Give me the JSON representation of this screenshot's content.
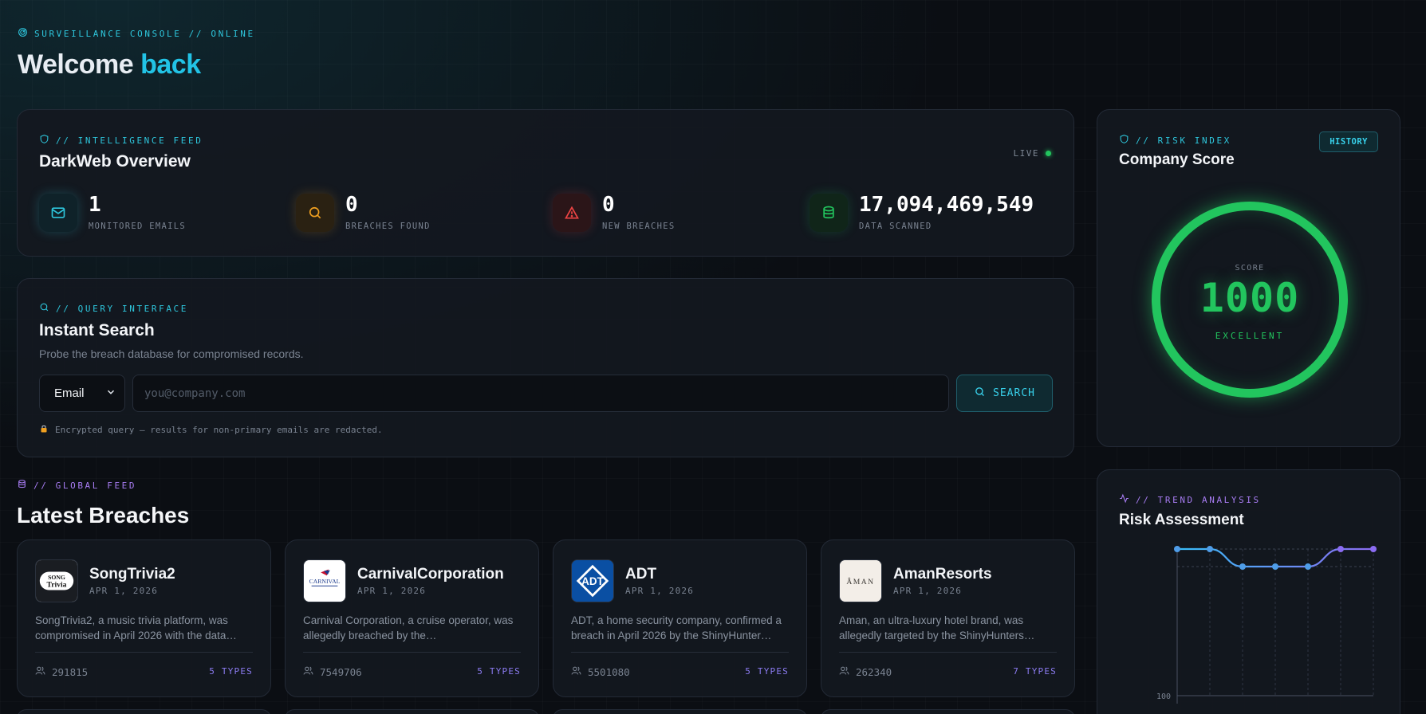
{
  "header": {
    "kicker": "SURVEILLANCE CONSOLE // ONLINE",
    "title_prefix": "Welcome",
    "title_accent": "back"
  },
  "overview": {
    "kicker": "// INTELLIGENCE FEED",
    "title": "DarkWeb Overview",
    "live_label": "LIVE",
    "stats": [
      {
        "value": "1",
        "label": "MONITORED EMAILS",
        "icon": "mail-icon",
        "color": "#2ec6dc"
      },
      {
        "value": "0",
        "label": "BREACHES FOUND",
        "icon": "search-icon",
        "color": "#f0a020"
      },
      {
        "value": "0",
        "label": "NEW BREACHES",
        "icon": "alert-triangle-icon",
        "color": "#ef4444"
      },
      {
        "value": "17,094,469,549",
        "label": "DATA SCANNED",
        "icon": "database-icon",
        "color": "#22c55e"
      }
    ]
  },
  "search": {
    "kicker": "// QUERY INTERFACE",
    "title": "Instant Search",
    "subtitle": "Probe the breach database for compromised records.",
    "type_selected": "Email",
    "placeholder": "you@company.com",
    "button_label": "SEARCH",
    "note": "Encrypted query — results for non-primary emails are redacted."
  },
  "feed": {
    "kicker": "// GLOBAL FEED",
    "title": "Latest Breaches",
    "items": [
      {
        "name": "SongTrivia2",
        "date": "APR 1, 2026",
        "desc": "SongTrivia2, a music trivia platform, was compromised in April 2026 with the data…",
        "count": "291815",
        "types": "5 TYPES",
        "logo_text": "SONG Trivia"
      },
      {
        "name": "CarnivalCorporation",
        "date": "APR 1, 2026",
        "desc": "Carnival Corporation, a cruise operator, was allegedly breached by the…",
        "count": "7549706",
        "types": "5 TYPES",
        "logo_text": "CARNIVAL"
      },
      {
        "name": "ADT",
        "date": "APR 1, 2026",
        "desc": "ADT, a home security company, confirmed a breach in April 2026 by the ShinyHunter…",
        "count": "5501080",
        "types": "5 TYPES",
        "logo_text": "ADT"
      },
      {
        "name": "AmanResorts",
        "date": "APR 1, 2026",
        "desc": "Aman, an ultra-luxury hotel brand, was allegedly targeted by the ShinyHunters…",
        "count": "262340",
        "types": "7 TYPES",
        "logo_text": "ÂMAN"
      }
    ]
  },
  "risk": {
    "kicker": "// RISK INDEX",
    "title": "Company Score",
    "history_label": "HISTORY",
    "score_label": "SCORE",
    "score": "1000",
    "tier": "EXCELLENT",
    "color": "#22c55e"
  },
  "trend": {
    "kicker": "// TREND ANALYSIS",
    "title": "Risk Assessment"
  },
  "chart_data": {
    "type": "line",
    "title": "",
    "y_tick_labels": [
      "100"
    ],
    "values": [
      1000,
      1000,
      960,
      960,
      960,
      1000,
      1000
    ],
    "color": "#8b6cf2"
  }
}
